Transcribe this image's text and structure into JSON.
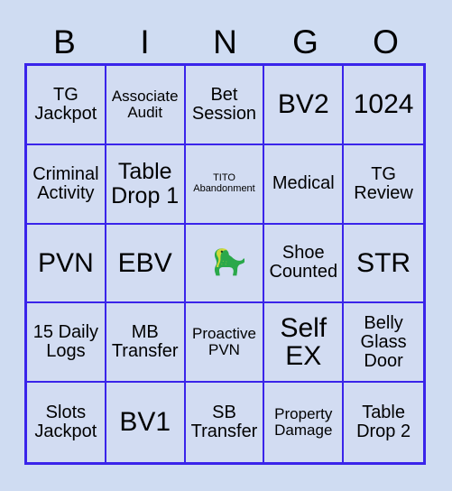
{
  "header": {
    "letters": [
      "B",
      "I",
      "N",
      "G",
      "O"
    ]
  },
  "colors": {
    "background": "#cfdcf2",
    "cell_background": "#d2dcf2",
    "grid_line": "#3a24ea",
    "text": "#000000",
    "dino_green": "#2aa84a",
    "dino_highlight": "#cfd93a"
  },
  "grid": {
    "rows": 5,
    "columns": 5,
    "cells": [
      [
        {
          "label": "TG Jackpot",
          "size": "md"
        },
        {
          "label": "Associate Audit",
          "size": "sm"
        },
        {
          "label": "Bet Session",
          "size": "md"
        },
        {
          "label": "BV2",
          "size": "xl"
        },
        {
          "label": "1024",
          "size": "xl"
        }
      ],
      [
        {
          "label": "Criminal Activity",
          "size": "md"
        },
        {
          "label": "Table Drop 1",
          "size": "lg"
        },
        {
          "label": "TITO Abandonment",
          "size": "xs"
        },
        {
          "label": "Medical",
          "size": "md"
        },
        {
          "label": "TG Review",
          "size": "md"
        }
      ],
      [
        {
          "label": "PVN",
          "size": "xl"
        },
        {
          "label": "EBV",
          "size": "xl"
        },
        {
          "label": "",
          "size": "md",
          "icon": "dinosaur-free-space"
        },
        {
          "label": "Shoe Counted",
          "size": "md"
        },
        {
          "label": "STR",
          "size": "xl"
        }
      ],
      [
        {
          "label": "15 Daily Logs",
          "size": "md"
        },
        {
          "label": "MB Transfer",
          "size": "md"
        },
        {
          "label": "Proactive PVN",
          "size": "sm"
        },
        {
          "label": "Self EX",
          "size": "xl"
        },
        {
          "label": "Belly Glass Door",
          "size": "md"
        }
      ],
      [
        {
          "label": "Slots Jackpot",
          "size": "md"
        },
        {
          "label": "BV1",
          "size": "xl"
        },
        {
          "label": "SB Transfer",
          "size": "md"
        },
        {
          "label": "Property Damage",
          "size": "sm"
        },
        {
          "label": "Table Drop 2",
          "size": "md"
        }
      ]
    ]
  }
}
